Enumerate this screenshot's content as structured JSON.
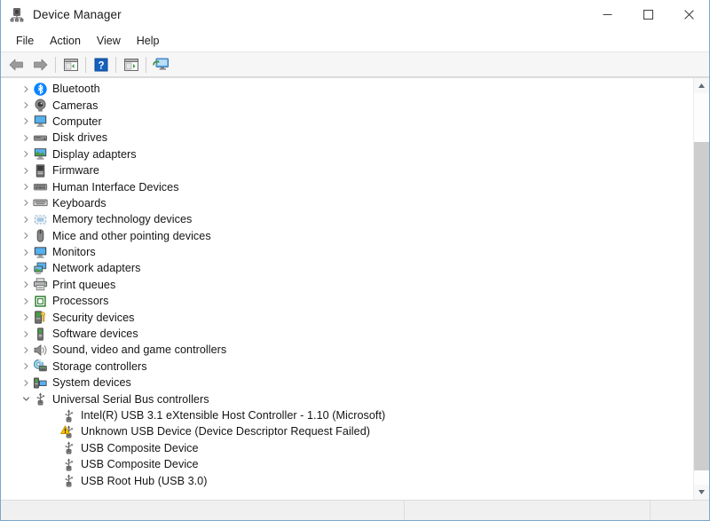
{
  "window": {
    "title": "Device Manager",
    "title_icon": "device-manager-icon",
    "controls": {
      "minimize": "minimize-icon",
      "maximize": "maximize-icon",
      "close": "close-icon"
    }
  },
  "menubar": {
    "items": [
      {
        "label": "File"
      },
      {
        "label": "Action"
      },
      {
        "label": "View"
      },
      {
        "label": "Help"
      }
    ]
  },
  "toolbar": {
    "buttons": [
      {
        "name": "back-arrow-icon",
        "tip": "Back"
      },
      {
        "name": "forward-arrow-icon",
        "tip": "Forward"
      },
      {
        "name": "show-hide-console-tree-icon",
        "tip": "Show/Hide Console Tree"
      },
      {
        "name": "help-icon",
        "tip": "Help"
      },
      {
        "name": "properties-icon",
        "tip": "Properties"
      },
      {
        "name": "scan-for-hardware-changes-icon",
        "tip": "Scan for hardware changes"
      }
    ]
  },
  "tree": {
    "nodes": [
      {
        "label": "Bluetooth",
        "icon": "bluetooth-icon",
        "level": 0,
        "state": "collapsed",
        "warning": false
      },
      {
        "label": "Cameras",
        "icon": "camera-icon",
        "level": 0,
        "state": "collapsed",
        "warning": false
      },
      {
        "label": "Computer",
        "icon": "computer-icon",
        "level": 0,
        "state": "collapsed",
        "warning": false
      },
      {
        "label": "Disk drives",
        "icon": "disk-drive-icon",
        "level": 0,
        "state": "collapsed",
        "warning": false
      },
      {
        "label": "Display adapters",
        "icon": "display-adapter-icon",
        "level": 0,
        "state": "collapsed",
        "warning": false
      },
      {
        "label": "Firmware",
        "icon": "firmware-icon",
        "level": 0,
        "state": "collapsed",
        "warning": false
      },
      {
        "label": "Human Interface Devices",
        "icon": "hid-icon",
        "level": 0,
        "state": "collapsed",
        "warning": false
      },
      {
        "label": "Keyboards",
        "icon": "keyboard-icon",
        "level": 0,
        "state": "collapsed",
        "warning": false
      },
      {
        "label": "Memory technology devices",
        "icon": "memory-technology-icon",
        "level": 0,
        "state": "collapsed",
        "warning": false
      },
      {
        "label": "Mice and other pointing devices",
        "icon": "mouse-icon",
        "level": 0,
        "state": "collapsed",
        "warning": false
      },
      {
        "label": "Monitors",
        "icon": "monitor-icon",
        "level": 0,
        "state": "collapsed",
        "warning": false
      },
      {
        "label": "Network adapters",
        "icon": "network-adapter-icon",
        "level": 0,
        "state": "collapsed",
        "warning": false
      },
      {
        "label": "Print queues",
        "icon": "printer-icon",
        "level": 0,
        "state": "collapsed",
        "warning": false
      },
      {
        "label": "Processors",
        "icon": "processor-icon",
        "level": 0,
        "state": "collapsed",
        "warning": false
      },
      {
        "label": "Security devices",
        "icon": "security-device-icon",
        "level": 0,
        "state": "collapsed",
        "warning": false
      },
      {
        "label": "Software devices",
        "icon": "software-device-icon",
        "level": 0,
        "state": "collapsed",
        "warning": false
      },
      {
        "label": "Sound, video and game controllers",
        "icon": "speaker-icon",
        "level": 0,
        "state": "collapsed",
        "warning": false
      },
      {
        "label": "Storage controllers",
        "icon": "storage-controller-icon",
        "level": 0,
        "state": "collapsed",
        "warning": false
      },
      {
        "label": "System devices",
        "icon": "system-device-icon",
        "level": 0,
        "state": "collapsed",
        "warning": false
      },
      {
        "label": "Universal Serial Bus controllers",
        "icon": "usb-icon",
        "level": 0,
        "state": "expanded",
        "warning": false
      },
      {
        "label": "Intel(R) USB 3.1 eXtensible Host Controller - 1.10 (Microsoft)",
        "icon": "usb-icon",
        "level": 1,
        "state": "leaf",
        "warning": false
      },
      {
        "label": "Unknown USB Device (Device Descriptor Request Failed)",
        "icon": "usb-icon",
        "level": 1,
        "state": "leaf",
        "warning": true
      },
      {
        "label": "USB Composite Device",
        "icon": "usb-icon",
        "level": 1,
        "state": "leaf",
        "warning": false
      },
      {
        "label": "USB Composite Device",
        "icon": "usb-icon",
        "level": 1,
        "state": "leaf",
        "warning": false
      },
      {
        "label": "USB Root Hub (USB 3.0)",
        "icon": "usb-icon",
        "level": 1,
        "state": "leaf",
        "warning": false
      }
    ]
  },
  "scrollbar": {
    "up_arrow": "scroll-up-arrow-icon",
    "down_arrow": "scroll-down-arrow-icon"
  },
  "statusbar": {
    "segments": [
      "",
      "",
      ""
    ]
  },
  "colors": {
    "window_border": "#7ba7cc",
    "toolbar_bg": "#f6f6f6",
    "warning": "#ffc400",
    "bluetooth": "#0a84ff",
    "accent": "#1b7fd4"
  }
}
